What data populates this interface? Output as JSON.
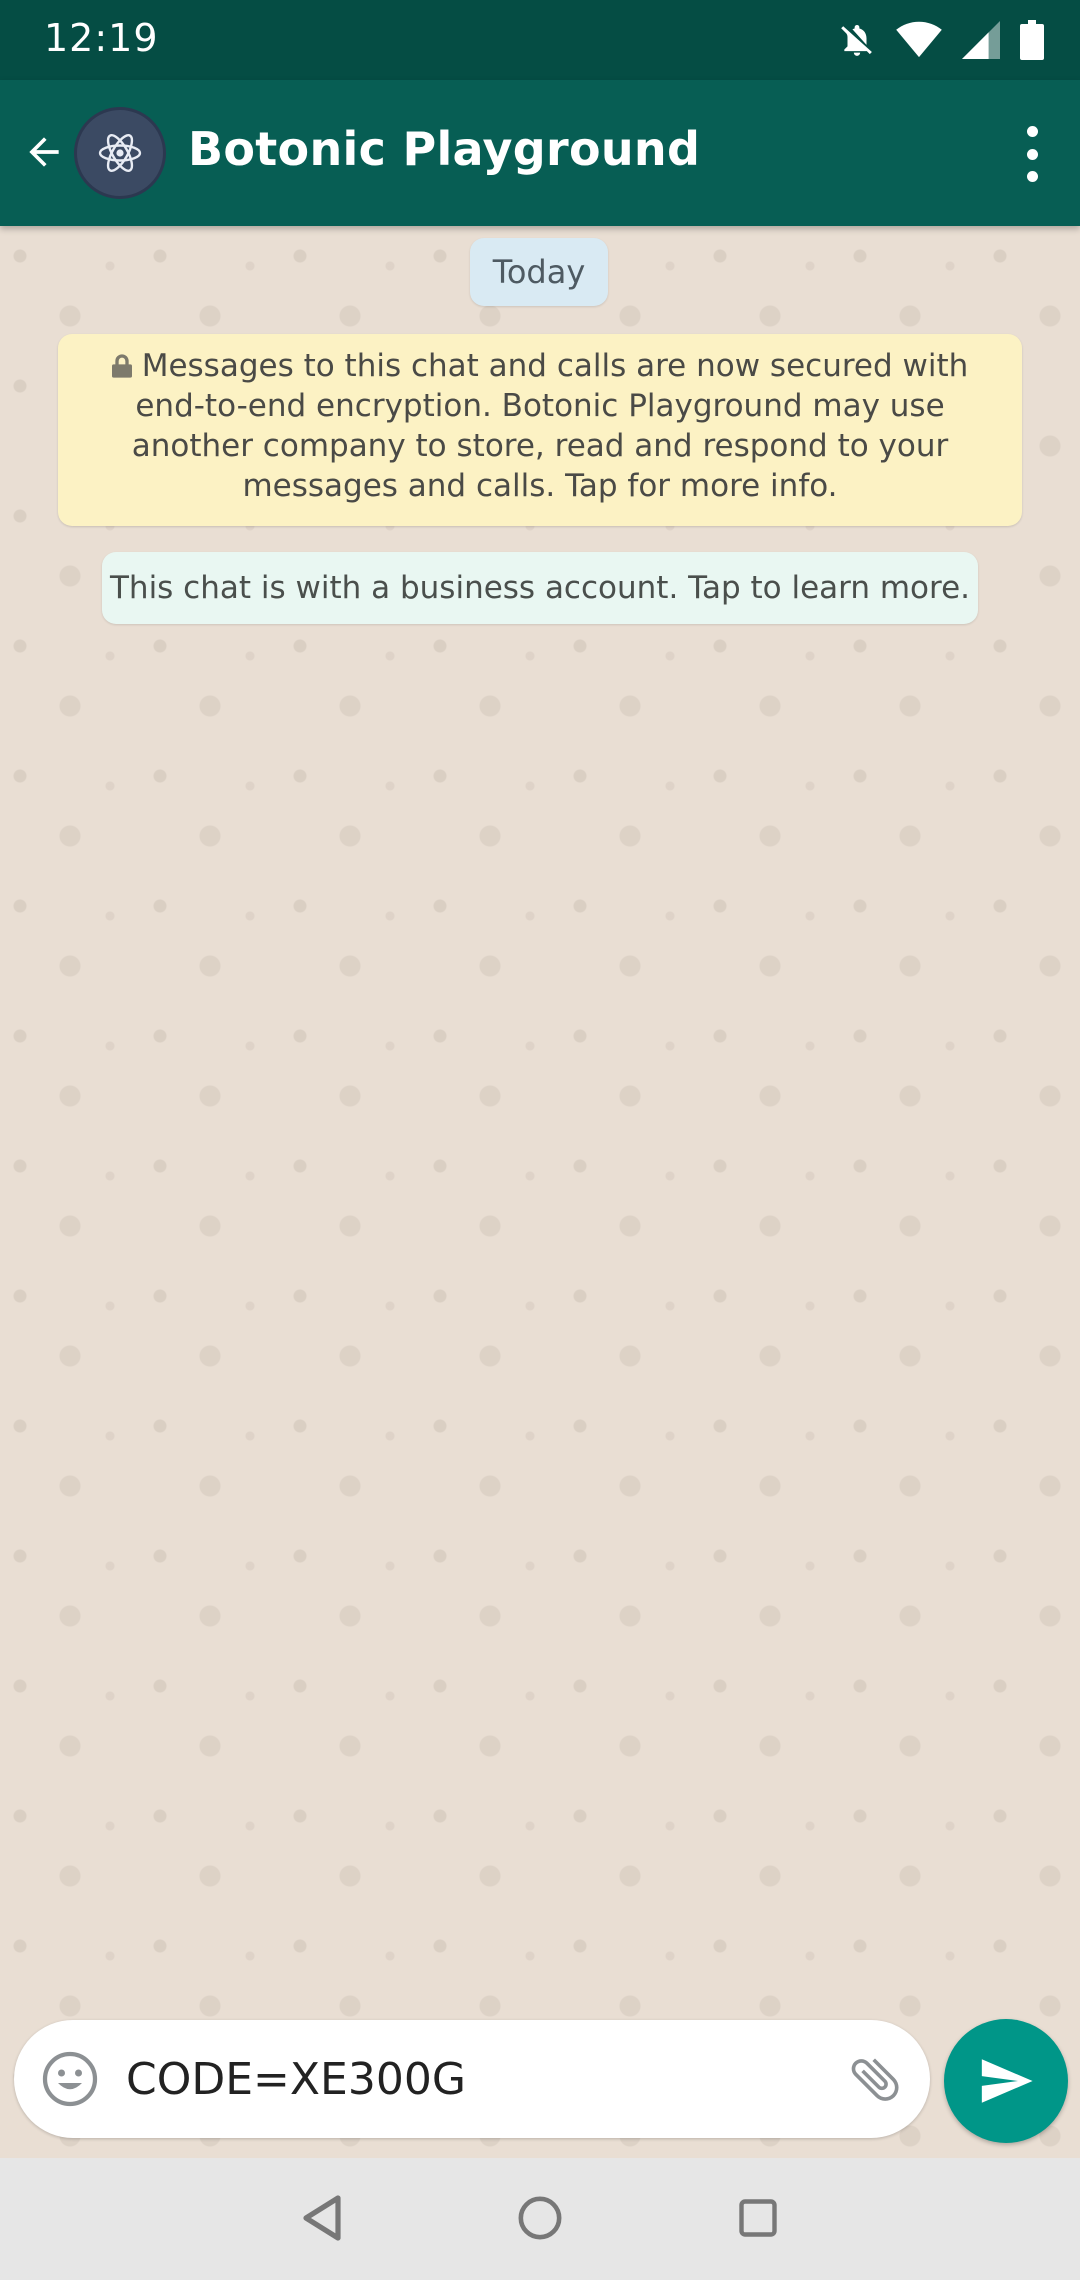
{
  "status_bar": {
    "time": "12:19",
    "icons": [
      "notifications-muted-icon",
      "wifi-icon",
      "cellular-signal-icon",
      "battery-icon"
    ]
  },
  "app_bar": {
    "title": "Botonic Playground",
    "avatar_icon": "react-atom-icon",
    "back_icon": "arrow-left-icon",
    "menu_icon": "more-vertical-icon"
  },
  "chat": {
    "date_chip": "Today",
    "encryption_lines": [
      "Messages to this chat and calls are now secured with",
      "end-to-end encryption. Botonic Playground may use",
      "another company to store, read and respond to your",
      "messages and calls. Tap for more info."
    ],
    "business_notice": "This chat is with a business account. Tap to learn more."
  },
  "composer": {
    "value": "CODE=XE300G",
    "emoji_icon": "smiley-icon",
    "attach_icon": "paperclip-icon",
    "send_icon": "send-icon"
  },
  "nav_bar": {
    "icons": [
      "back-triangle-icon",
      "home-circle-icon",
      "recents-square-icon"
    ]
  },
  "colors": {
    "status_bar": "#054d44",
    "app_bar": "#075e54",
    "accent": "#009688",
    "chat_background": "#e9ded3",
    "encryption_bubble": "#fcf2c4",
    "business_bubble": "#e9f7f2",
    "date_chip": "#d9eaf3"
  }
}
